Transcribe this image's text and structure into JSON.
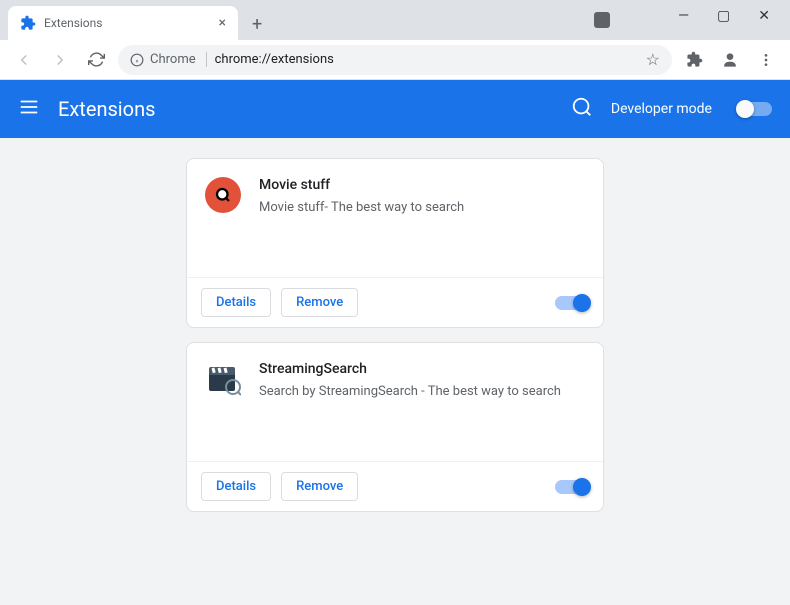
{
  "window": {
    "tab_title": "Extensions"
  },
  "toolbar": {
    "omnibox_prefix": "Chrome",
    "omnibox_url": "chrome://extensions"
  },
  "header": {
    "title": "Extensions",
    "developer_mode_label": "Developer mode"
  },
  "extensions": [
    {
      "name": "Movie stuff",
      "description": "Movie stuff- The best way to search",
      "details_label": "Details",
      "remove_label": "Remove",
      "enabled": true,
      "icon_type": "orange-search"
    },
    {
      "name": "StreamingSearch",
      "description": "Search by StreamingSearch - The best way to search",
      "details_label": "Details",
      "remove_label": "Remove",
      "enabled": true,
      "icon_type": "clapper"
    }
  ]
}
